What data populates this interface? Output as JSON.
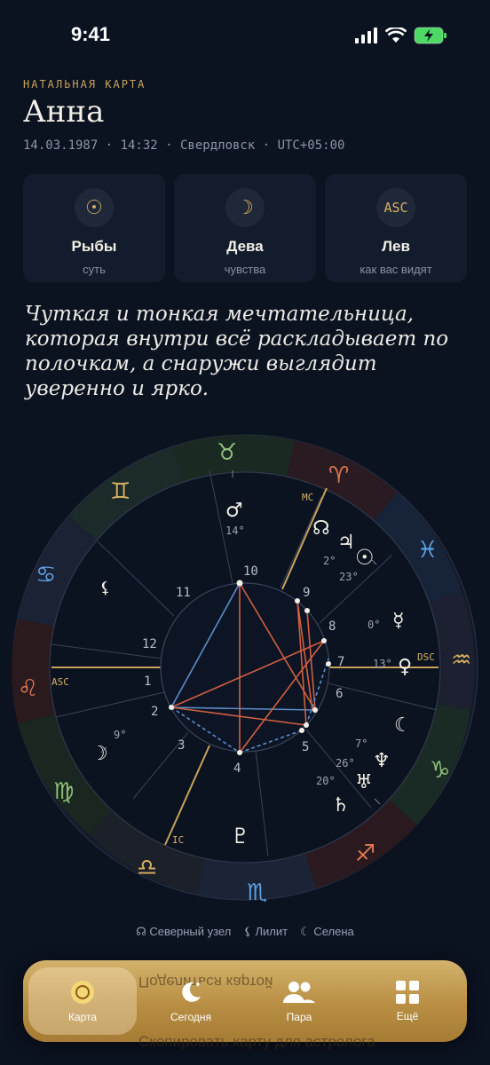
{
  "status": {
    "time": "9:41"
  },
  "header": {
    "overline": "НАТАЛЬНАЯ КАРТА",
    "name": "Анна",
    "meta": "14.03.1987 · 14:32 · Свердловск · UTC+05:00"
  },
  "cards": [
    {
      "icon": "sun-icon",
      "glyph": "☉",
      "sign": "Рыбы",
      "sub": "суть"
    },
    {
      "icon": "moon-icon",
      "glyph": "☽",
      "sign": "Дева",
      "sub": "чувства"
    },
    {
      "icon": "ascendant-icon",
      "glyph": "ASC",
      "sign": "Лев",
      "sub": "как вас видят"
    }
  ],
  "quote": "Чуткая и тонкая мечтательница, которая внутри всё раскладывает по полочкам, а снаружи выглядит уверенно и ярко.",
  "wheel": {
    "angles": {
      "asc": "ASC",
      "dsc": "DSC",
      "mc": "MC",
      "ic": "IC"
    },
    "houses": [
      "1",
      "2",
      "3",
      "4",
      "5",
      "6",
      "7",
      "8",
      "9",
      "10",
      "11",
      "12"
    ],
    "planet_degrees": {
      "mars": "14°",
      "jupiter": "2°",
      "sun": "23°",
      "mercury": "0°",
      "venus": "13°",
      "moon": "9°",
      "neptune": "7°",
      "uranus": "26°",
      "saturn": "20°"
    }
  },
  "legend": [
    {
      "glyph": "☊",
      "label": "Северный узел"
    },
    {
      "glyph": "⚸",
      "label": "Лилит"
    },
    {
      "glyph": "☾",
      "label": "Селена"
    }
  ],
  "behind_text": {
    "share": "Поделиться картой",
    "copy": "Скопировать карту для астролога"
  },
  "tabs": [
    {
      "label": "Карта",
      "icon": "chart-sun-icon"
    },
    {
      "label": "Сегодня",
      "icon": "moon-stars-icon"
    },
    {
      "label": "Пара",
      "icon": "people-icon"
    },
    {
      "label": "Ещё",
      "icon": "grid-icon"
    }
  ],
  "colors": {
    "accent": "#d9b061",
    "bg": "#0b1220",
    "card": "#131c2c",
    "tabbar": "#c9a35a"
  }
}
